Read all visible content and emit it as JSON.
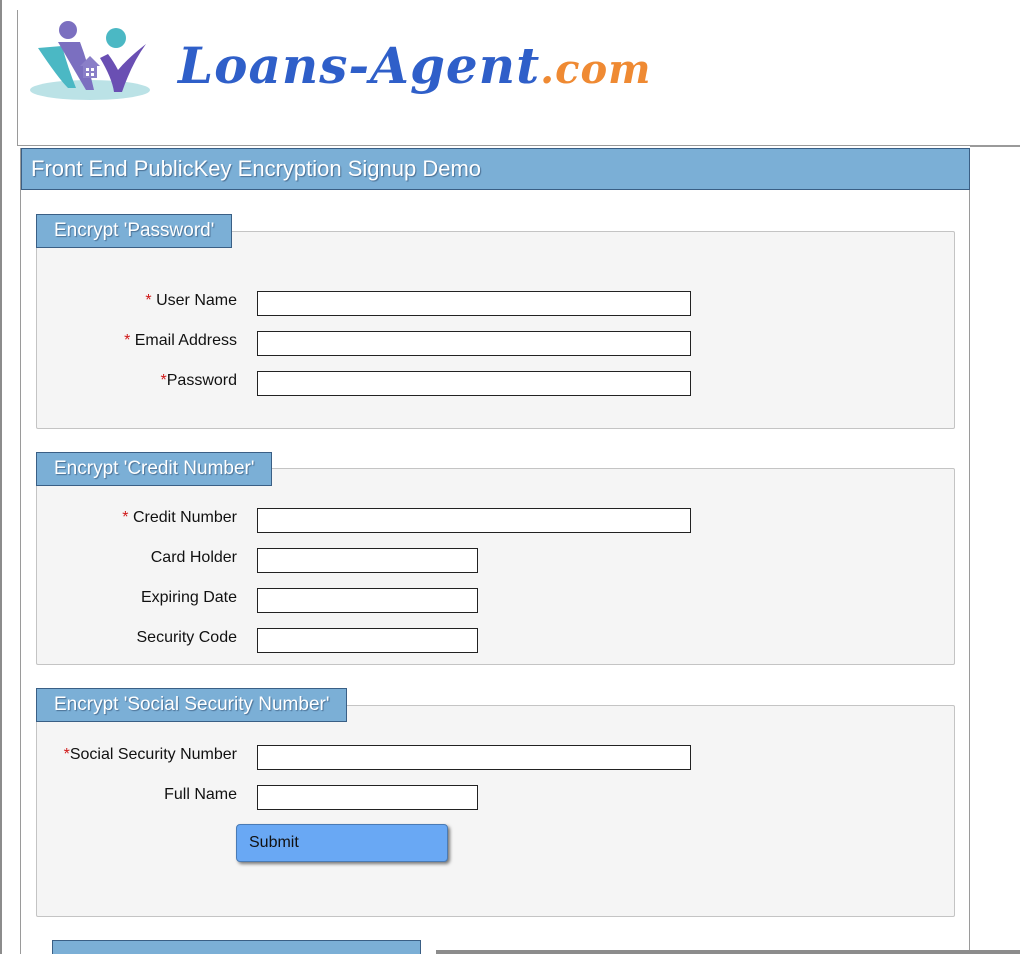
{
  "header": {
    "logo_text_main": "Loans-Agent",
    "logo_text_suffix": ".com"
  },
  "panel": {
    "title": "Front End PublicKey Encryption Signup Demo"
  },
  "sections": [
    {
      "legend": "Encrypt 'Password'",
      "fields": [
        {
          "required_marker": "* ",
          "label": "User Name",
          "value": ""
        },
        {
          "required_marker": "* ",
          "label": "Email Address",
          "value": ""
        },
        {
          "required_marker": "*",
          "label": "Password",
          "value": ""
        }
      ]
    },
    {
      "legend": "Encrypt 'Credit Number'",
      "fields": [
        {
          "required_marker": "* ",
          "label": "Credit Number",
          "value": ""
        },
        {
          "required_marker": "",
          "label": "Card Holder",
          "value": ""
        },
        {
          "required_marker": "",
          "label": "Expiring Date",
          "value": ""
        },
        {
          "required_marker": "",
          "label": "Security Code",
          "value": ""
        }
      ]
    },
    {
      "legend": "Encrypt 'Social Security Number'",
      "fields": [
        {
          "required_marker": "*",
          "label": "Social Security Number",
          "value": ""
        },
        {
          "required_marker": "",
          "label": "Full Name",
          "value": ""
        }
      ]
    }
  ],
  "submit_label": "Submit",
  "colors": {
    "accent": "#7bafd6",
    "required": "#d01818",
    "button": "#69a8f4",
    "logo_blue": "#2f5fc9",
    "logo_orange": "#ef8a33"
  }
}
